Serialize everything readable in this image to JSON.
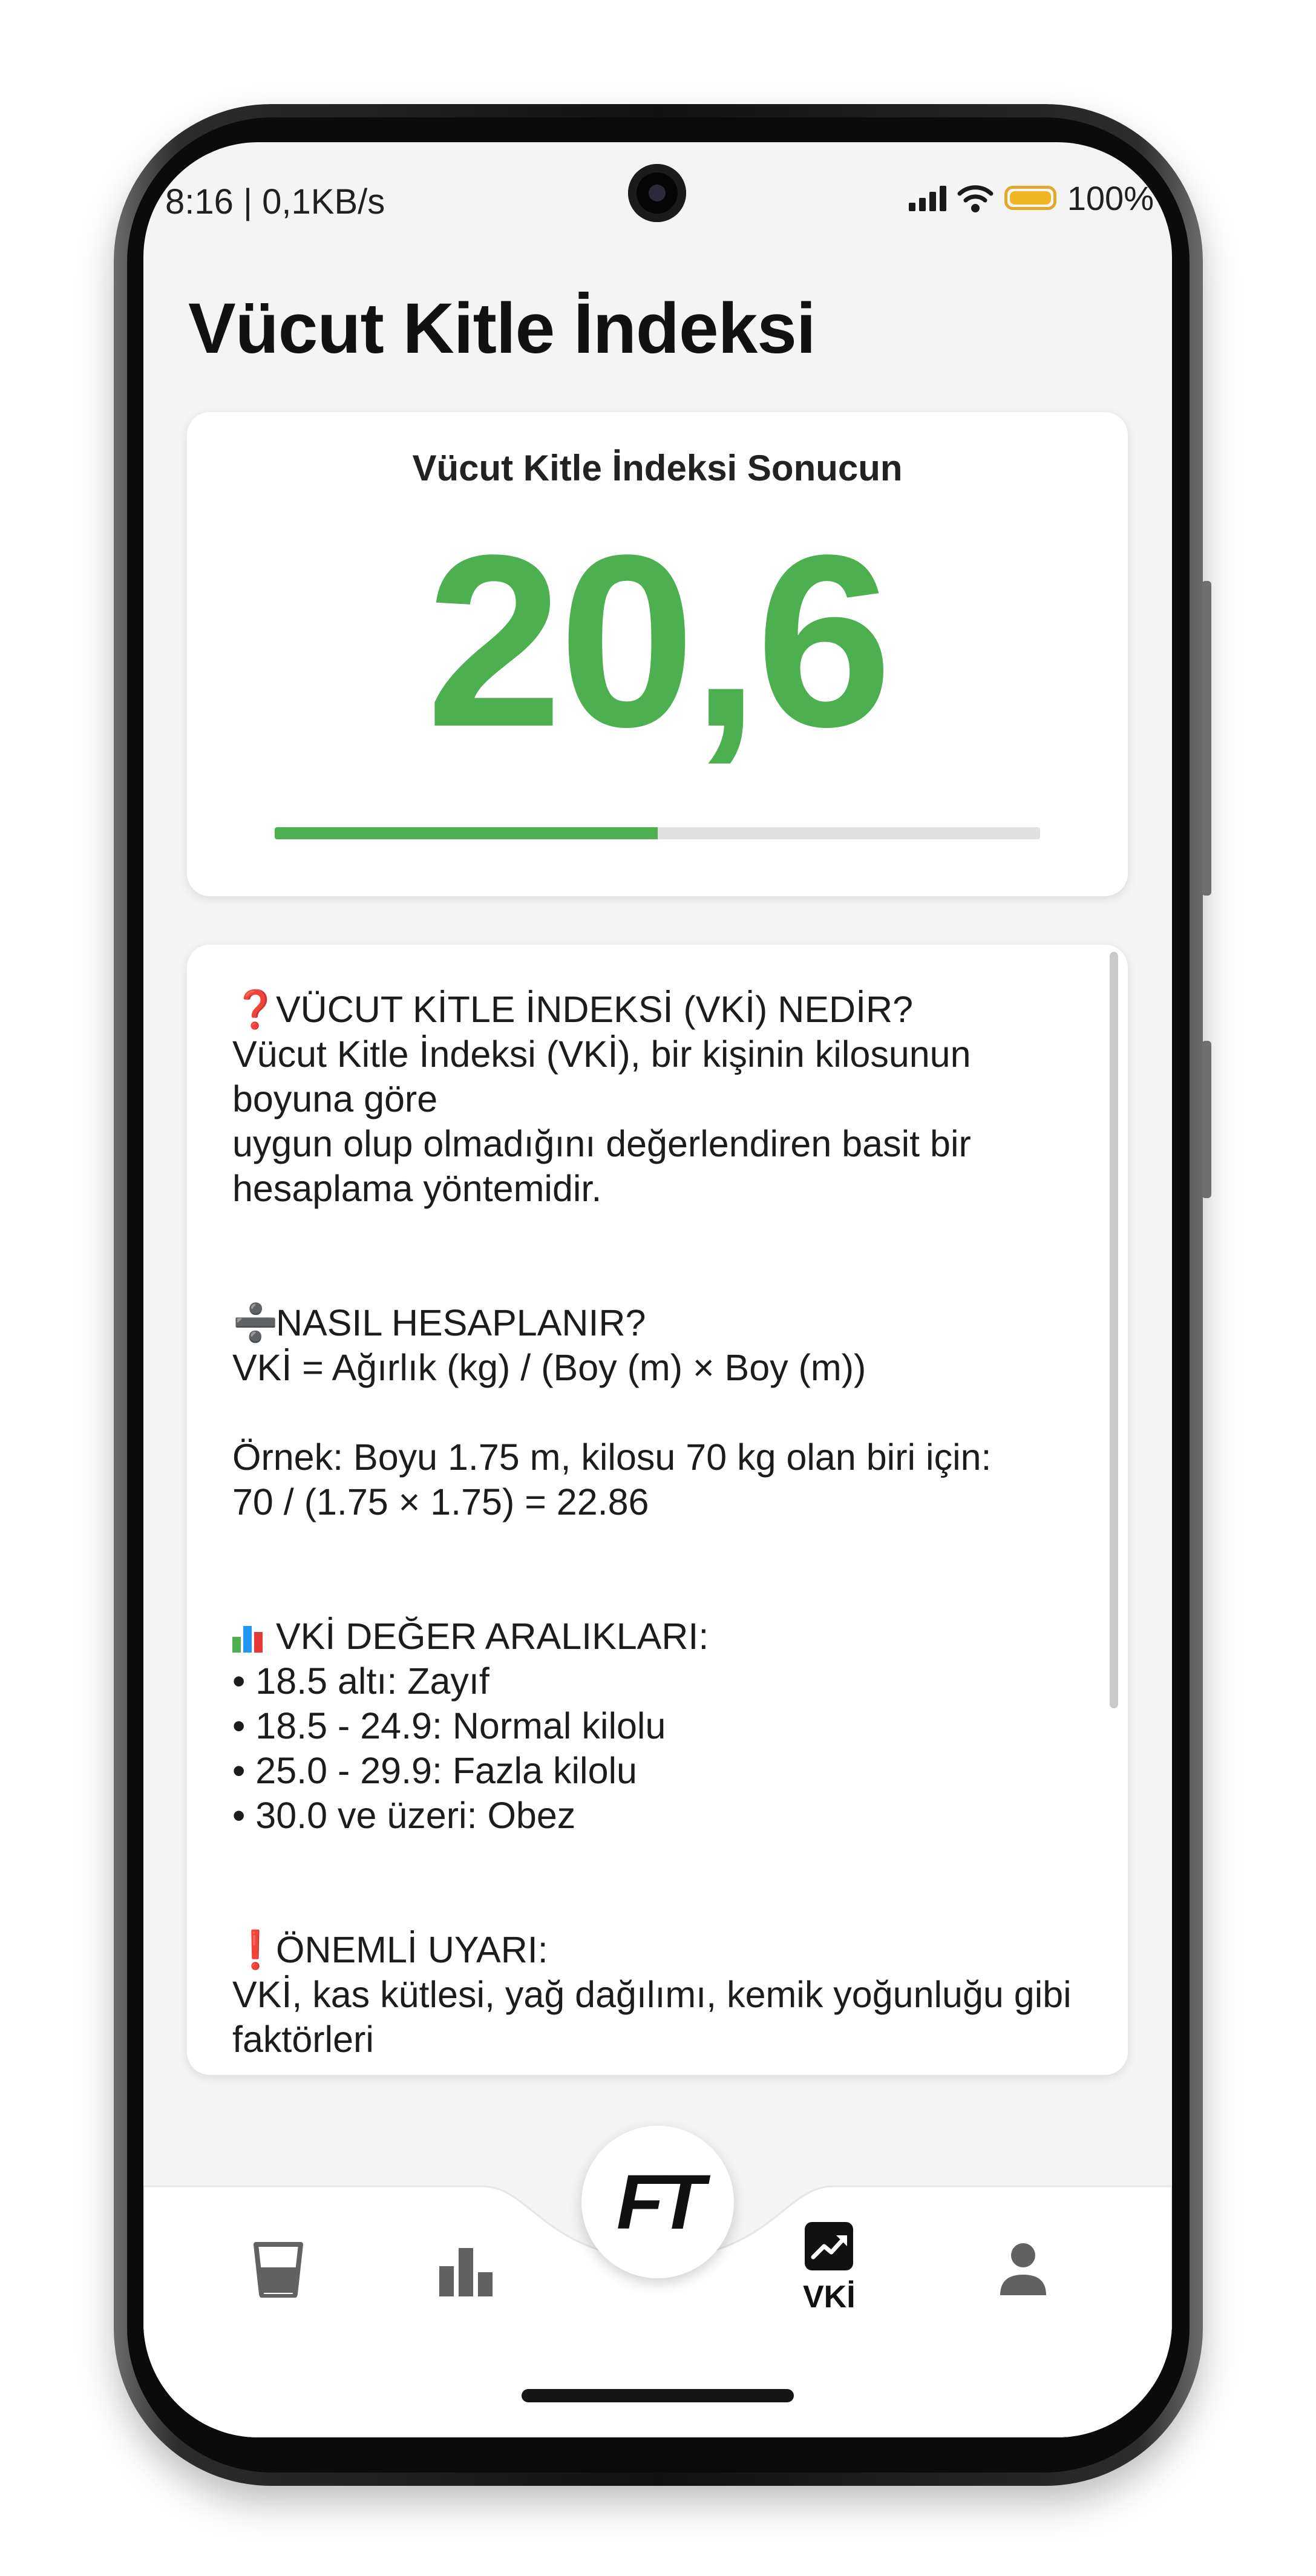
{
  "status_bar": {
    "time_speed": "8:16 | 0,1KB/s",
    "battery_percent": "100%"
  },
  "page": {
    "title": "Vücut Kitle İndeksi"
  },
  "result": {
    "label": "Vücut Kitle İndeksi Sonucun",
    "value": "20,6",
    "progress_fraction": 0.5,
    "accent_color": "#4caf50"
  },
  "info": {
    "section_what": {
      "icon": "question-mark-icon",
      "heading": "VÜCUT KİTLE İNDEKSİ (VKİ) NEDİR?",
      "lines": [
        "Vücut Kitle İndeksi (VKİ), bir kişinin kilosunun",
        "boyuna göre",
        "uygun olup olmadığını değerlendiren basit bir",
        "hesaplama yöntemidir."
      ]
    },
    "section_how": {
      "icon": "divide-icon",
      "heading": "NASIL HESAPLANIR?",
      "formula": "VKİ = Ağırlık (kg) / (Boy (m) × Boy (m))",
      "example_lines": [
        "Örnek: Boyu 1.75 m, kilosu 70 kg olan biri için:",
        "70 / (1.75 × 1.75) = 22.86"
      ]
    },
    "section_ranges": {
      "icon": "bar-chart-icon",
      "heading": "VKİ DEĞER ARALIKLARI:",
      "items": [
        "• 18.5 altı: Zayıf",
        "• 18.5 - 24.9: Normal kilolu",
        "• 25.0 - 29.9: Fazla kilolu",
        "• 30.0 ve üzeri: Obez"
      ]
    },
    "section_warning": {
      "icon": "exclamation-icon",
      "heading": "ÖNEMLİ UYARI:",
      "lines": [
        "VKİ, kas kütlesi, yağ dağılımı, kemik yoğunluğu gibi",
        "faktörleri"
      ]
    }
  },
  "bottom_nav": {
    "fab_logo": "FT",
    "active_label": "VKİ",
    "items": [
      "water-glass-icon",
      "stats-bar-icon",
      "trend-icon",
      "person-icon"
    ]
  }
}
